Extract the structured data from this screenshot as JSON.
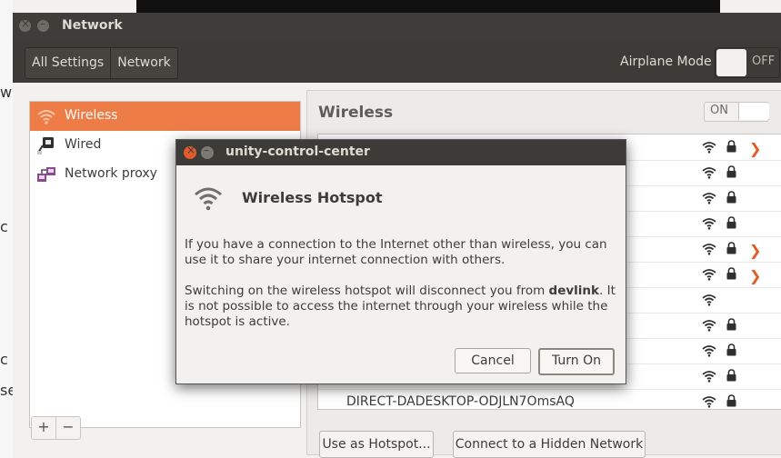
{
  "background_fragments": [
    "w",
    "c",
    "c",
    "se"
  ],
  "window": {
    "title": "Network",
    "breadcrumb": [
      "All Settings",
      "Network"
    ],
    "airplane": {
      "label": "Airplane Mode",
      "state": "OFF"
    }
  },
  "sidebar": {
    "items": [
      {
        "label": "Wireless",
        "icon": "wifi-icon",
        "selected": true
      },
      {
        "label": "Wired",
        "icon": "wired-network-icon",
        "selected": false
      },
      {
        "label": "Network proxy",
        "icon": "network-proxy-icon",
        "selected": false
      }
    ],
    "add_label": "+",
    "remove_label": "−"
  },
  "wireless": {
    "title": "Wireless",
    "switch_state": "ON",
    "networks": [
      {
        "ssid": "",
        "secured": true,
        "chevron": true
      },
      {
        "ssid": "",
        "secured": true,
        "chevron": false
      },
      {
        "ssid": "",
        "secured": true,
        "chevron": false
      },
      {
        "ssid": "",
        "secured": true,
        "chevron": false
      },
      {
        "ssid": "",
        "secured": true,
        "chevron": true
      },
      {
        "ssid": "",
        "secured": true,
        "chevron": true
      },
      {
        "ssid": "",
        "secured": false,
        "chevron": false
      },
      {
        "ssid": "",
        "secured": true,
        "chevron": false
      },
      {
        "ssid": "",
        "secured": true,
        "chevron": false
      },
      {
        "ssid": "",
        "secured": true,
        "chevron": false
      },
      {
        "ssid": "DIRECT-DADESKTOP-ODJLN7OmsAQ",
        "secured": true,
        "chevron": false
      }
    ],
    "hotspot_button": "Use as Hotspot...",
    "hidden_button": "Connect to a Hidden Network"
  },
  "dialog": {
    "title": "unity-control-center",
    "heading": "Wireless Hotspot",
    "para1": "If you have a connection to the Internet other than wireless, you can use it to share your internet connection with others.",
    "para2_before": "Switching on the wireless hotspot will disconnect you from ",
    "para2_network": "devlink",
    "para2_after": ". It is not possible to access the internet through your wireless while the hotspot is active.",
    "cancel": "Cancel",
    "confirm": "Turn On"
  },
  "colors": {
    "accent": "#ee7c47",
    "chevron": "#e05d25",
    "titlebar": "#3c3b37"
  }
}
